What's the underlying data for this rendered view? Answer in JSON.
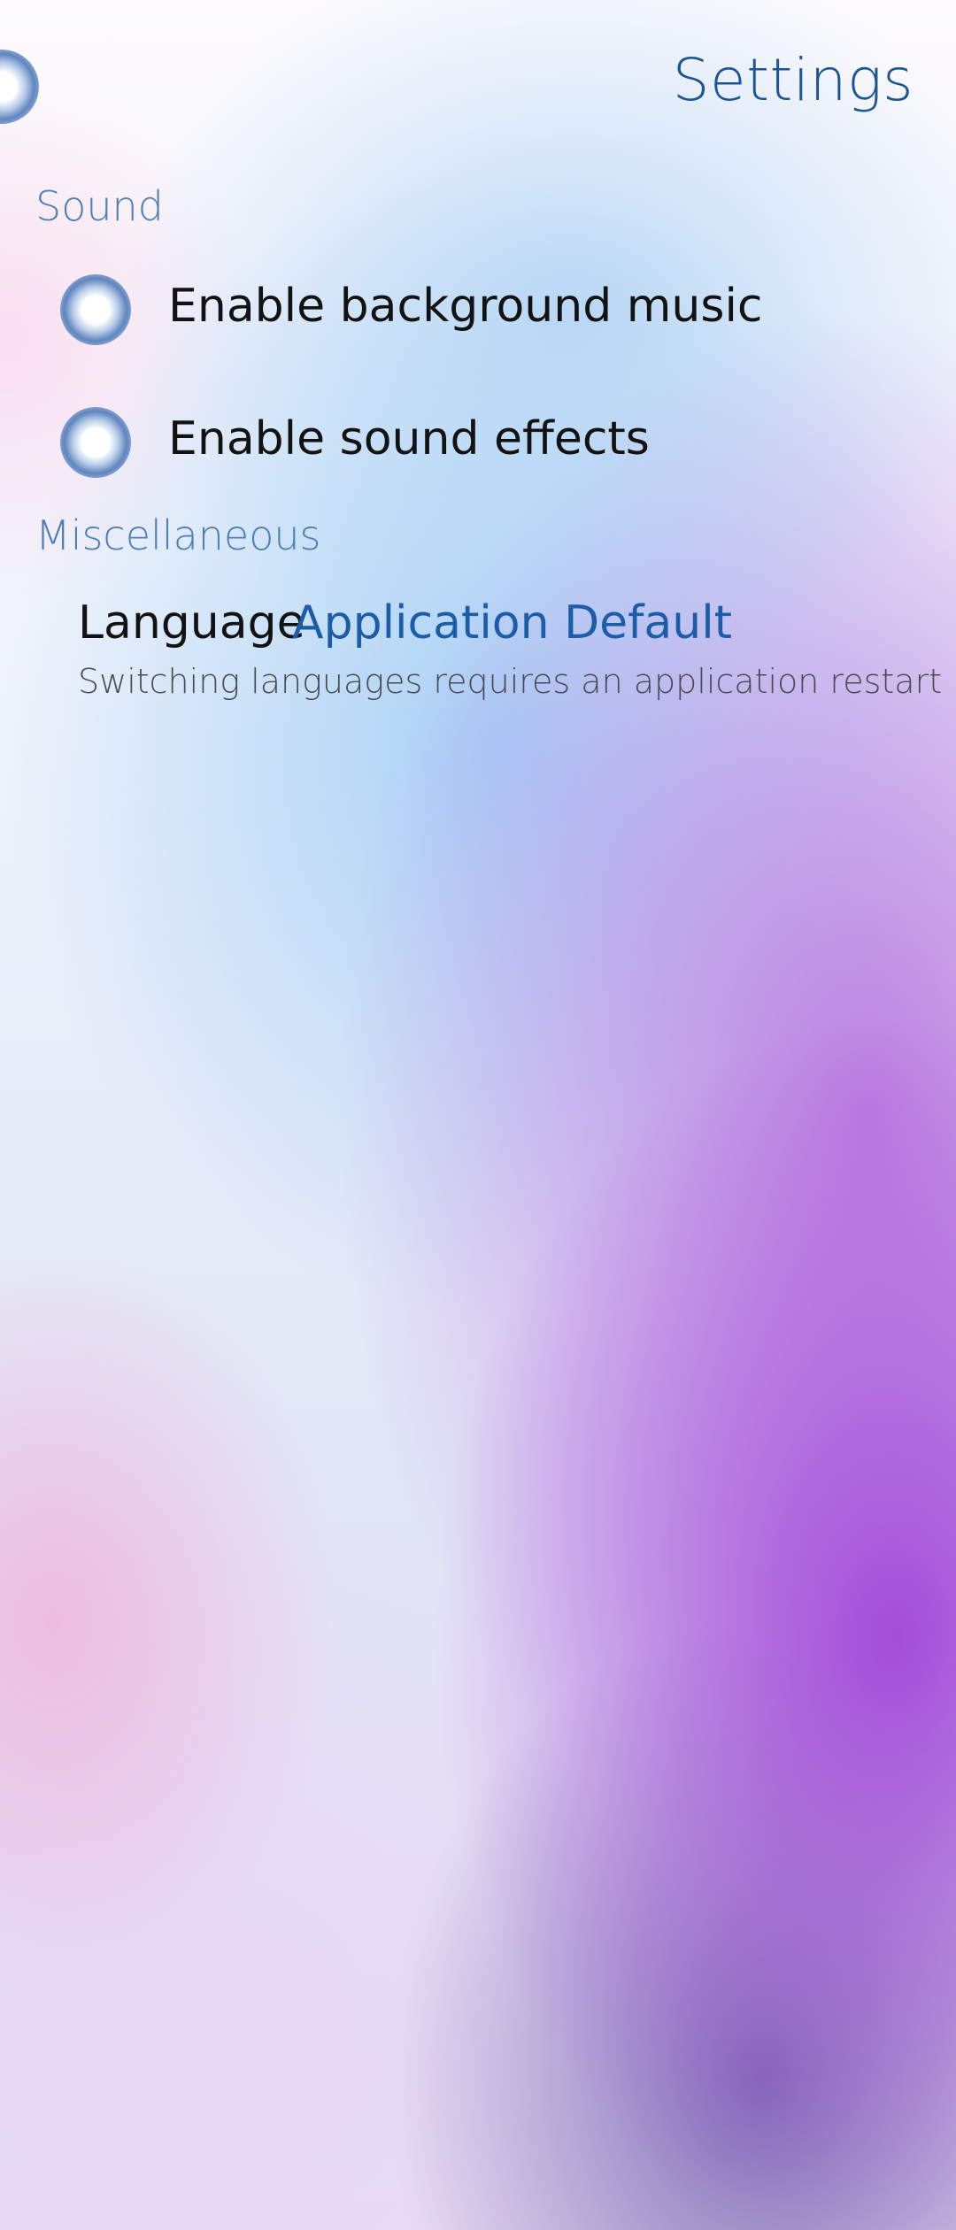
{
  "page": {
    "title": "Settings"
  },
  "sections": {
    "sound": {
      "header": "Sound",
      "background_music": {
        "label": "Enable background music",
        "checked": true
      },
      "sound_effects": {
        "label": "Enable sound effects",
        "checked": true
      }
    },
    "misc": {
      "header": "Miscellaneous",
      "language": {
        "label": "Language",
        "value": "Application Default",
        "description": "Switching languages requires an application restart"
      }
    }
  },
  "colors": {
    "accent": "#1c5595",
    "section_header": "#4f7fb5",
    "primary_text": "#121212",
    "secondary_text": "#4a4a55",
    "combo_value": "#1d5da8"
  },
  "icons": {
    "pulley_menu_indicator": "glow-indicator-icon",
    "switch_indicator": "glow-switch-icon"
  }
}
